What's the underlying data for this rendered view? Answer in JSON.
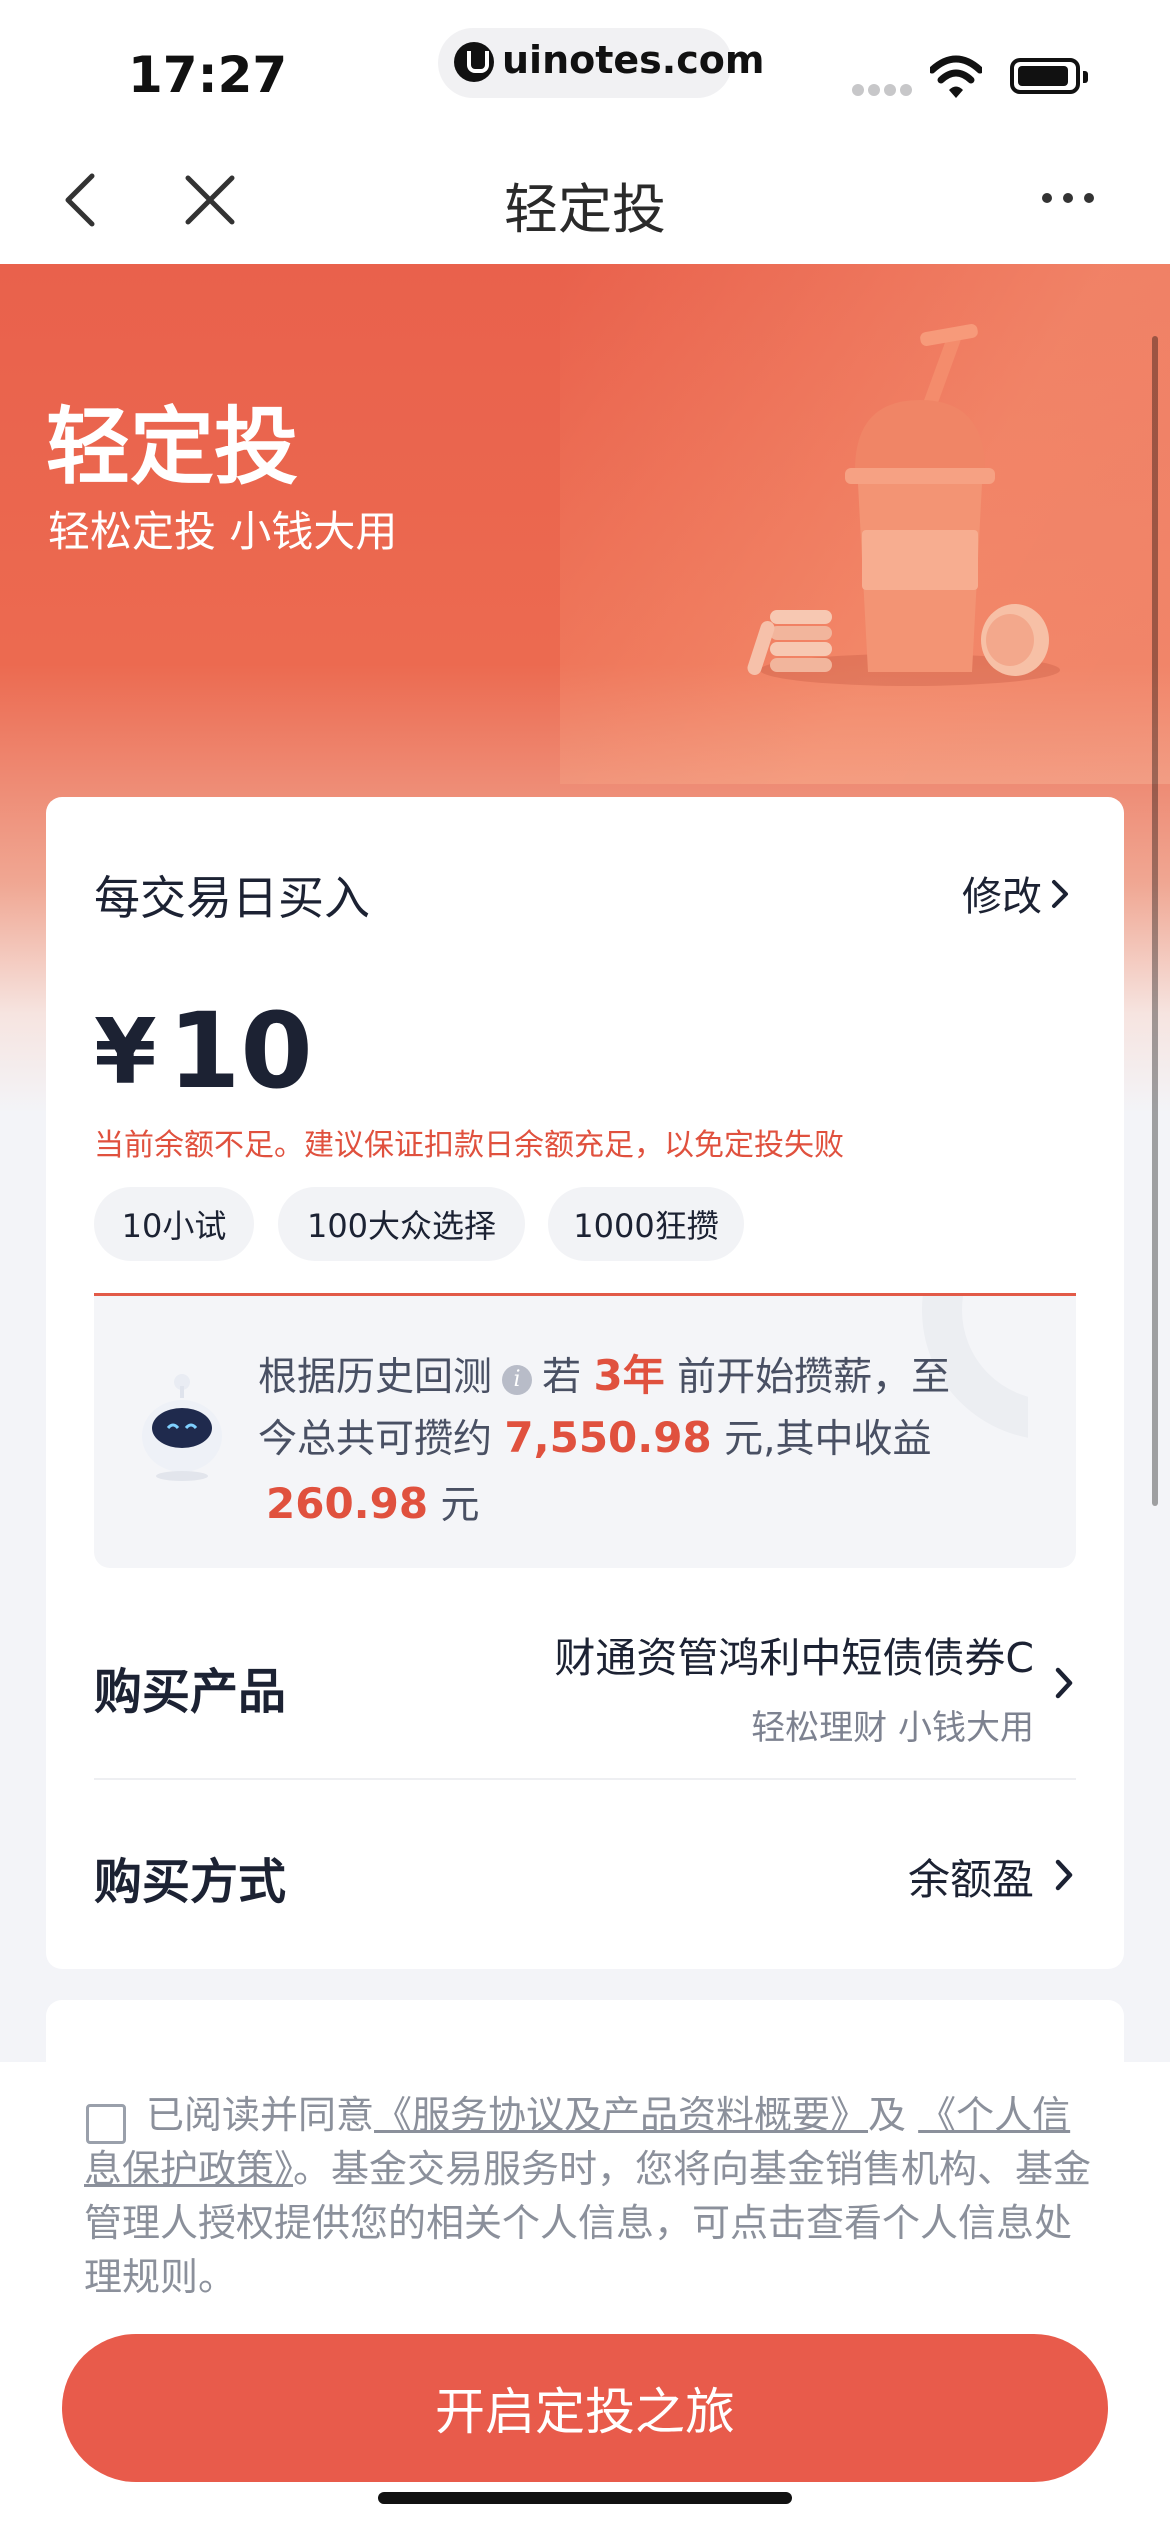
{
  "status_bar": {
    "time": "17:27",
    "url": "uinotes.com"
  },
  "nav": {
    "title": "轻定投"
  },
  "hero": {
    "title": "轻定投",
    "subtitle": "轻松定投 小钱大用"
  },
  "plan": {
    "section_title": "每交易日买入",
    "modify_label": "修改",
    "currency": "¥",
    "amount": "10",
    "warning": "当前余额不足。建议保证扣款日余额充足，以免定投失败",
    "presets": [
      "10小试",
      "100大众选择",
      "1000狂攒"
    ]
  },
  "backtest": {
    "line1_a": "根据历史回测",
    "line1_b": "若",
    "years": "3年",
    "line1_c": "前开始攒薪，至",
    "line2_a": "今总共可攒约",
    "total": "7,550.98",
    "line2_b": "元,其中收益",
    "profit": "260.98",
    "line3_b": "元"
  },
  "product": {
    "label": "购买产品",
    "name": "财通资管鸿利中短债债券C",
    "tagline": "轻松理财 小钱大用"
  },
  "payment": {
    "label": "购买方式",
    "value": "余额盈"
  },
  "agreement": {
    "prefix": "已阅读并同意",
    "link1": "《服务协议及产品资料概要》",
    "mid": "及",
    "link2": "《个人信息保护政策》",
    "suffix": "。基金交易服务时，您将向基金销售机构、基金管理人授权提供您的相关个人信息，可点击查看个人信息处理规则。"
  },
  "cta": {
    "label": "开启定投之旅"
  },
  "colors": {
    "accent": "#e85b4b",
    "highlight": "#e0513e",
    "text": "#1c2233"
  }
}
